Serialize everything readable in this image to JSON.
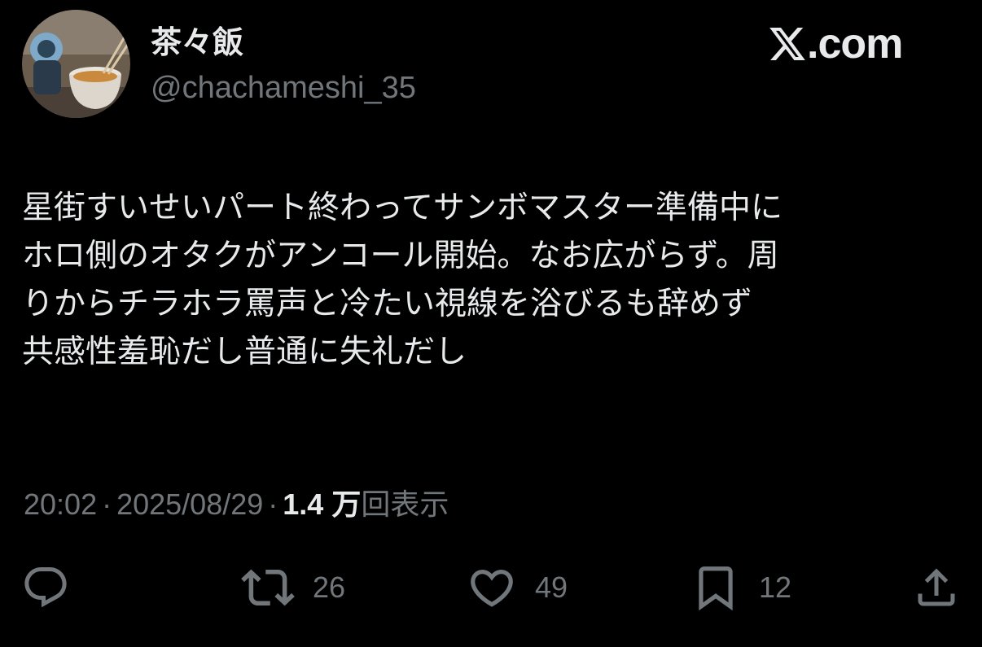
{
  "author": {
    "display_name": "茶々飯",
    "handle": "@chachameshi_35",
    "avatar_icon": "user-avatar-icon"
  },
  "brand": {
    "logo_icon": "x-logo-icon",
    "text": ".com"
  },
  "tweet": {
    "text": "星街すいせいパート終わってサンボマスター準備中に\nホロ側のオタクがアンコール開始。なお広がらず。周\nりからチラホラ罵声と冷たい視線を浴びるも辞めず\n共感性羞恥だし普通に失礼だし",
    "time": "20:02",
    "date": "2025/08/29",
    "separator": "·",
    "views_count": "1.4 万",
    "views_label": "回表示"
  },
  "actions": {
    "reply": {
      "icon": "reply-icon"
    },
    "retweet": {
      "icon": "retweet-icon",
      "count": "26"
    },
    "like": {
      "icon": "heart-icon",
      "count": "49"
    },
    "bookmark": {
      "icon": "bookmark-icon",
      "count": "12"
    },
    "share": {
      "icon": "share-icon"
    }
  },
  "colors": {
    "background": "#000000",
    "primary_text": "#e7e9ea",
    "secondary_text": "#71767b"
  }
}
